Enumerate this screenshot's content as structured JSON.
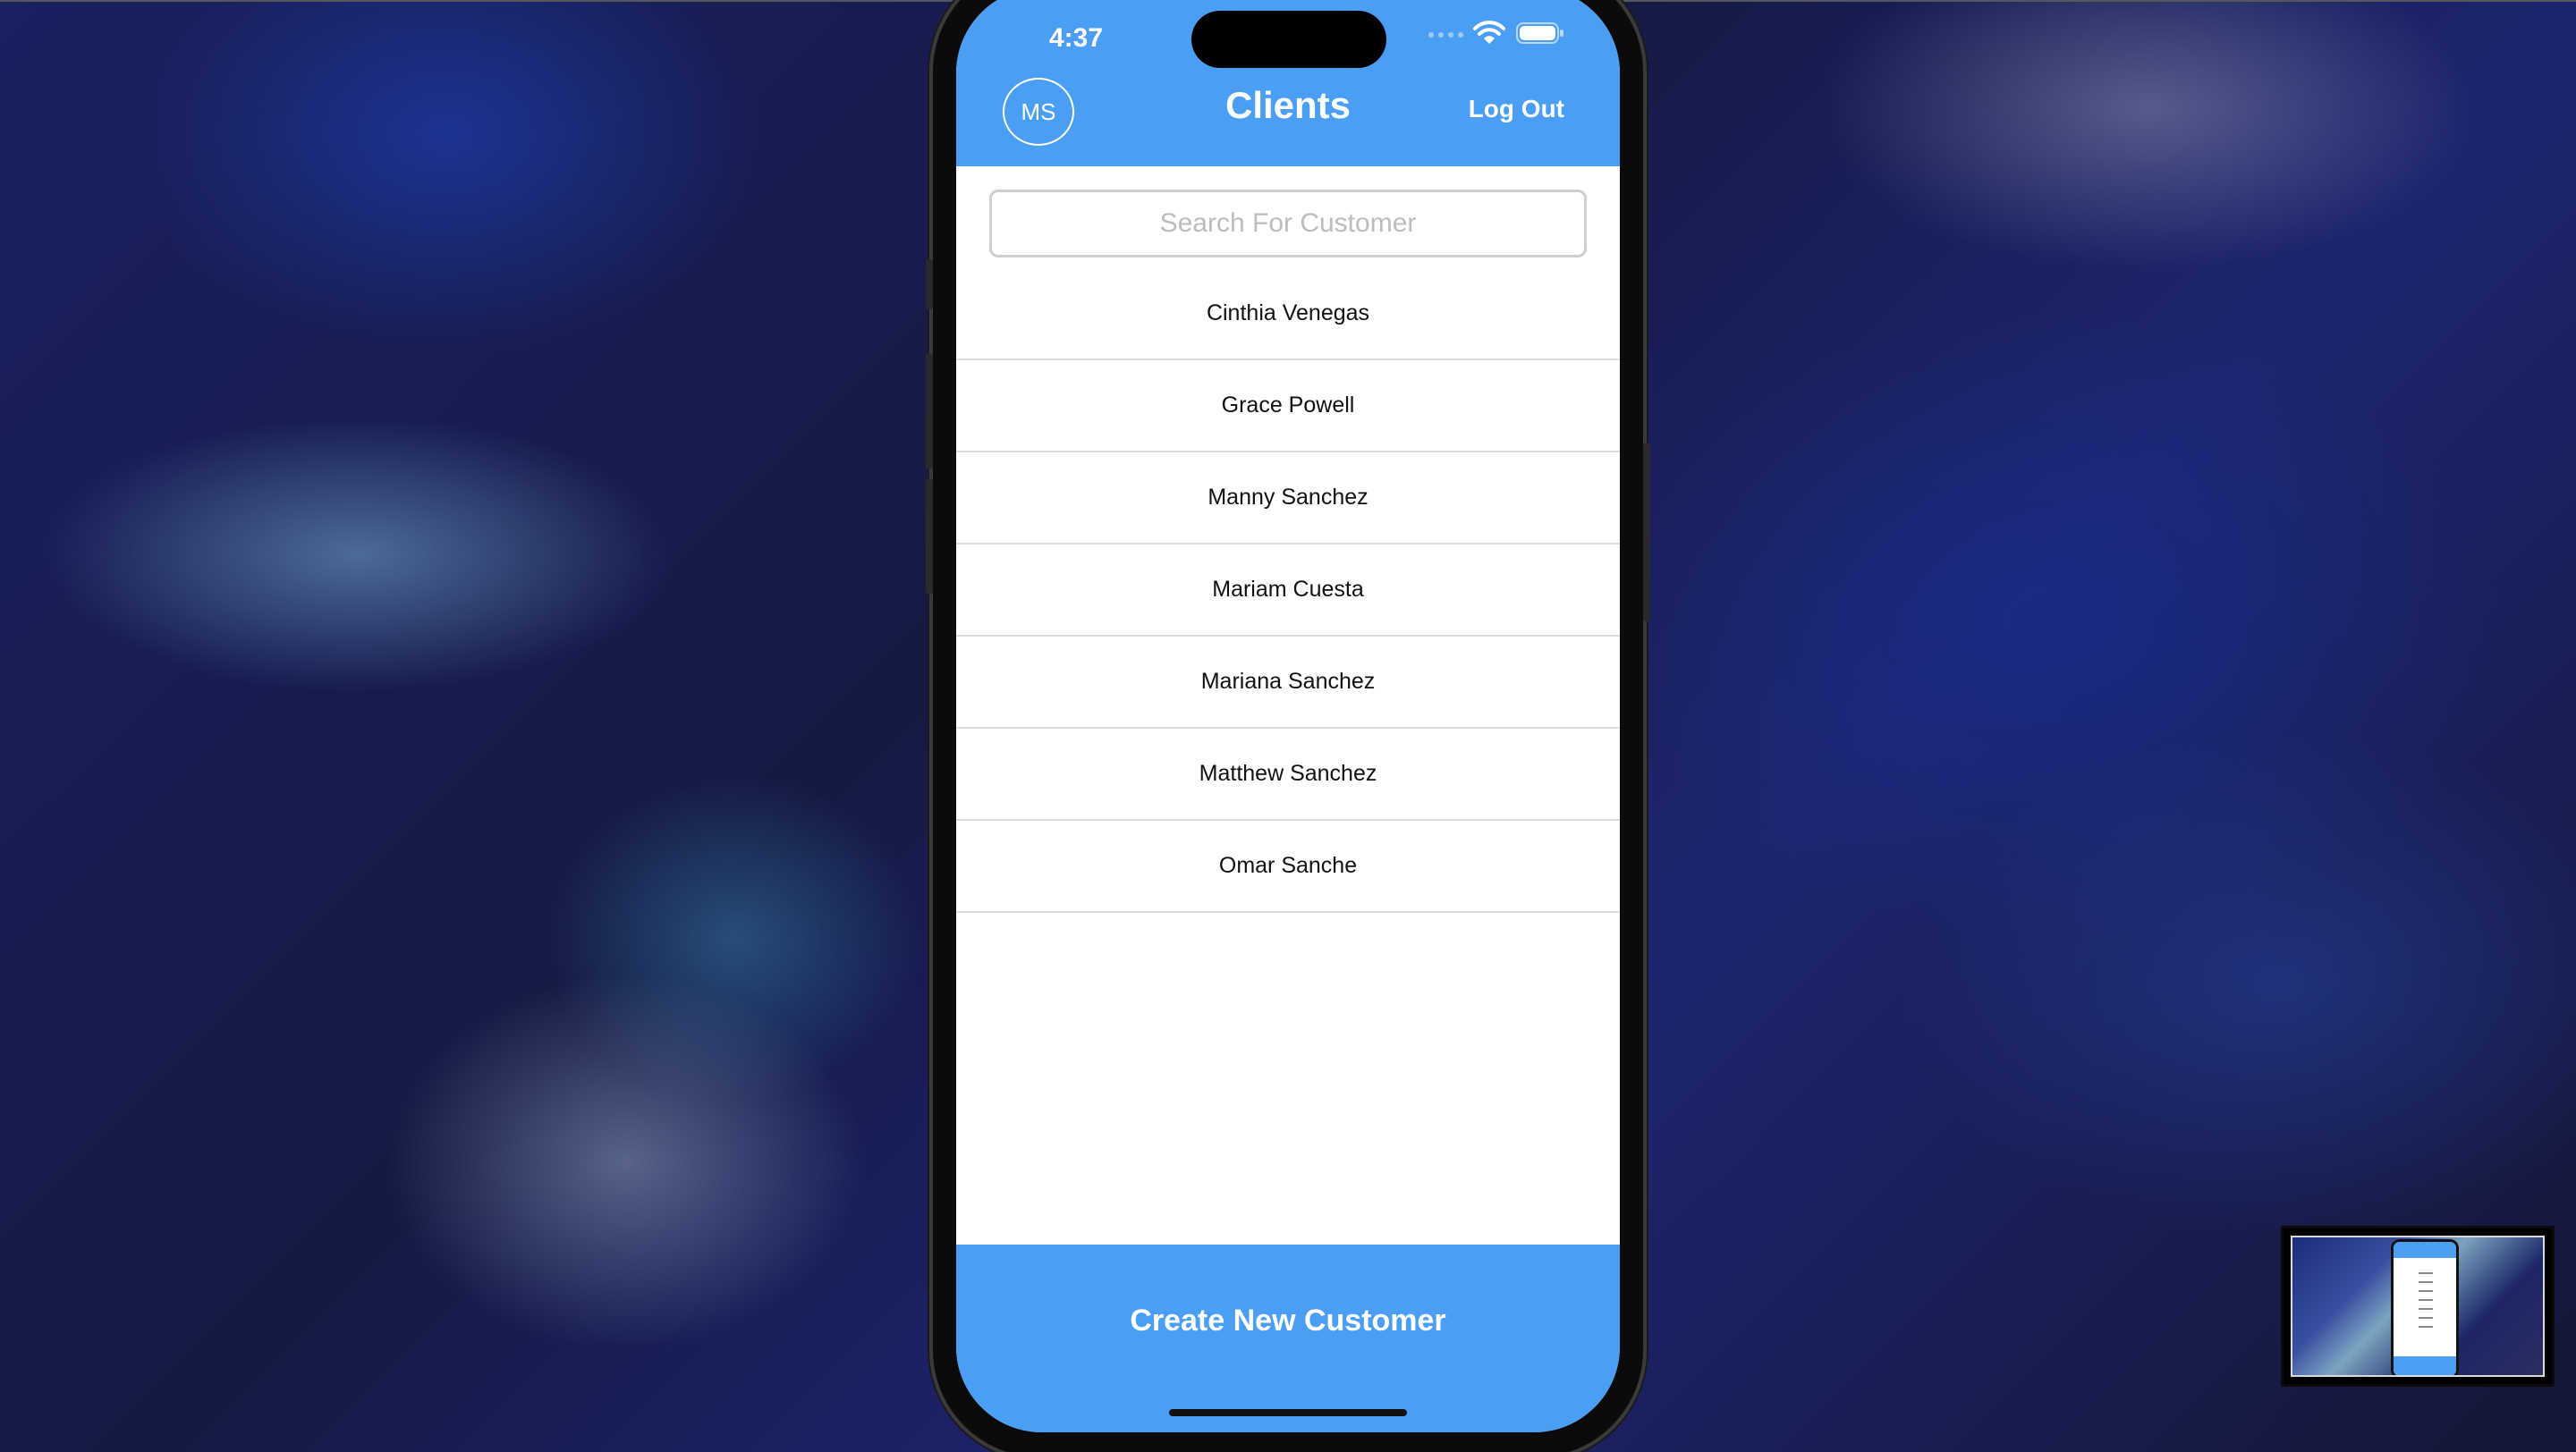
{
  "status_bar": {
    "time": "4:37",
    "wifi_icon": "wifi-icon",
    "battery_icon": "battery-icon"
  },
  "header": {
    "avatar_initials": "MS",
    "title": "Clients",
    "logout_label": "Log Out"
  },
  "search": {
    "placeholder": "Search For Customer",
    "value": ""
  },
  "clients": [
    "Cinthia Venegas",
    "Grace Powell",
    "Manny Sanchez",
    "Mariam Cuesta",
    "Mariana Sanchez",
    "Matthew Sanchez",
    "Omar Sanche"
  ],
  "footer": {
    "create_label": "Create New Customer"
  },
  "colors": {
    "accent": "#4a9ff5"
  }
}
